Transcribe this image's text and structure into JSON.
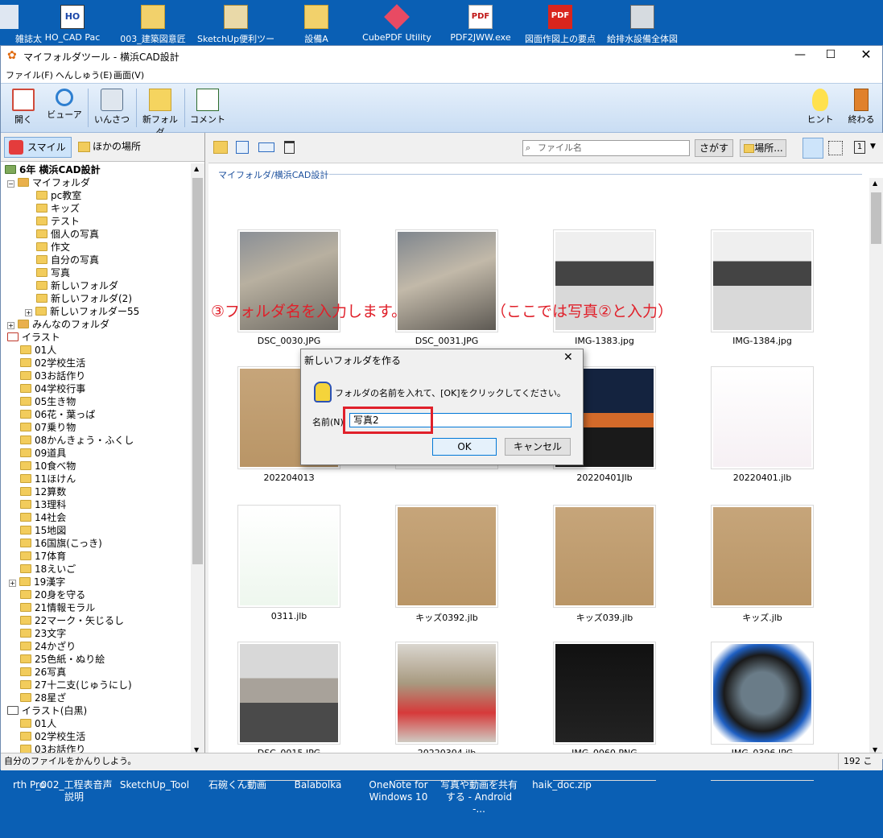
{
  "desktop": {
    "icons": [
      {
        "label": "雑誌太",
        "icon": "app-icon"
      },
      {
        "label": "HO_CAD Pac",
        "icon": "ho-cad-icon"
      },
      {
        "label": "003_建築図意匠",
        "icon": "folder-icon"
      },
      {
        "label": "SketchUp便利ツー",
        "icon": "zip-folder-icon"
      },
      {
        "label": "設備A",
        "icon": "folder-icon"
      },
      {
        "label": "CubePDF Utility",
        "icon": "cubepdf-icon"
      },
      {
        "label": "PDF2JWW.exe",
        "icon": "pdf2jww-icon"
      },
      {
        "label": "図面作図上の要点",
        "icon": "pdf-icon"
      },
      {
        "label": "給排水設備全体図",
        "icon": "drawing-icon"
      }
    ],
    "bottom_icons": [
      {
        "label": "rth Pro"
      },
      {
        "label": "_002_工程表音声説明"
      },
      {
        "label": "SketchUp_Tool"
      },
      {
        "label": "石碗くん動画"
      },
      {
        "label": "Balabolka"
      },
      {
        "label": "OneNote for Windows 10"
      },
      {
        "label": "写真や動画を共有する - Android -..."
      },
      {
        "label": "haik_doc.zip"
      }
    ]
  },
  "window": {
    "title": "マイフォルダツール - 横浜CAD設計",
    "menu": [
      "ファイル(F)",
      "へんしゅう(E)",
      "画面(V)"
    ],
    "toolbar": {
      "open": "開く",
      "viewer": "ビューア",
      "print": "いんさつ",
      "new_folder": "新フォルダ",
      "comment": "コメント",
      "hint": "ヒント",
      "exit": "終わる"
    },
    "left_tabs": {
      "smile": "スマイル",
      "other": "ほかの場所"
    },
    "tree": {
      "root": "6年 横浜CAD設計",
      "my_folder": "マイフォルダ",
      "my_children": [
        "pc教室",
        "キッズ",
        "テスト",
        "個人の写真",
        "作文",
        "自分の写真",
        "写真",
        "新しいフォルダ",
        "新しいフォルダ(2)",
        "新しいフォルダー55"
      ],
      "shared": "みんなのフォルダ",
      "illust": "イラスト",
      "illust_children": [
        "01人",
        "02学校生活",
        "03お話作り",
        "04学校行事",
        "05生き物",
        "06花・葉っぱ",
        "07乗り物",
        "08かんきょう・ふくし",
        "09道具",
        "10食べ物",
        "11ほけん",
        "12算数",
        "13理科",
        "14社会",
        "15地図",
        "16国旗(こっき)",
        "17体育",
        "18えいご",
        "19漢字",
        "20身を守る",
        "21情報モラル",
        "22マーク・矢じるし",
        "23文字",
        "24かざり",
        "25色紙・ぬり絵",
        "26写真",
        "27十二支(じゅうにし)",
        "28星ざ"
      ],
      "illust_bw": "イラスト(白黒)",
      "illust_bw_children": [
        "01人",
        "02学校生活",
        "03お話作り"
      ]
    },
    "right": {
      "search_placeholder": "ファイル名",
      "search_button": "さがす",
      "location_button": "場所...",
      "path": "マイフォルダ/横浜CAD設計"
    },
    "files": [
      "DSC_0030.JPG",
      "DSC_0031.JPG",
      "IMG-1383.jpg",
      "IMG-1384.jpg",
      "20220401З",
      "",
      "20220401Jlb",
      "20220401.jlb",
      "0311.jlb",
      "キッズ0392.jlb",
      "キッズ039.jlb",
      "キッズ.jlb",
      "DSC_0015.JPG",
      "20220304.jlb",
      "IMG_0060.PNG",
      "IMG_0396.JPG"
    ],
    "status": {
      "text": "自分のファイルをかんりしよう。",
      "count": "192 こ"
    }
  },
  "annotation": {
    "step": "③フォルダ名を入力します。",
    "note": "（ここでは写真②と入力）",
    "highlight_color": "#e0202a"
  },
  "dialog": {
    "title": "新しいフォルダを作る",
    "message": "フォルダの名前を入れて、[OK]をクリックしてください。",
    "name_label": "名前(N)",
    "name_value": "写真2",
    "ok": "OK",
    "cancel": "キャンセル"
  }
}
